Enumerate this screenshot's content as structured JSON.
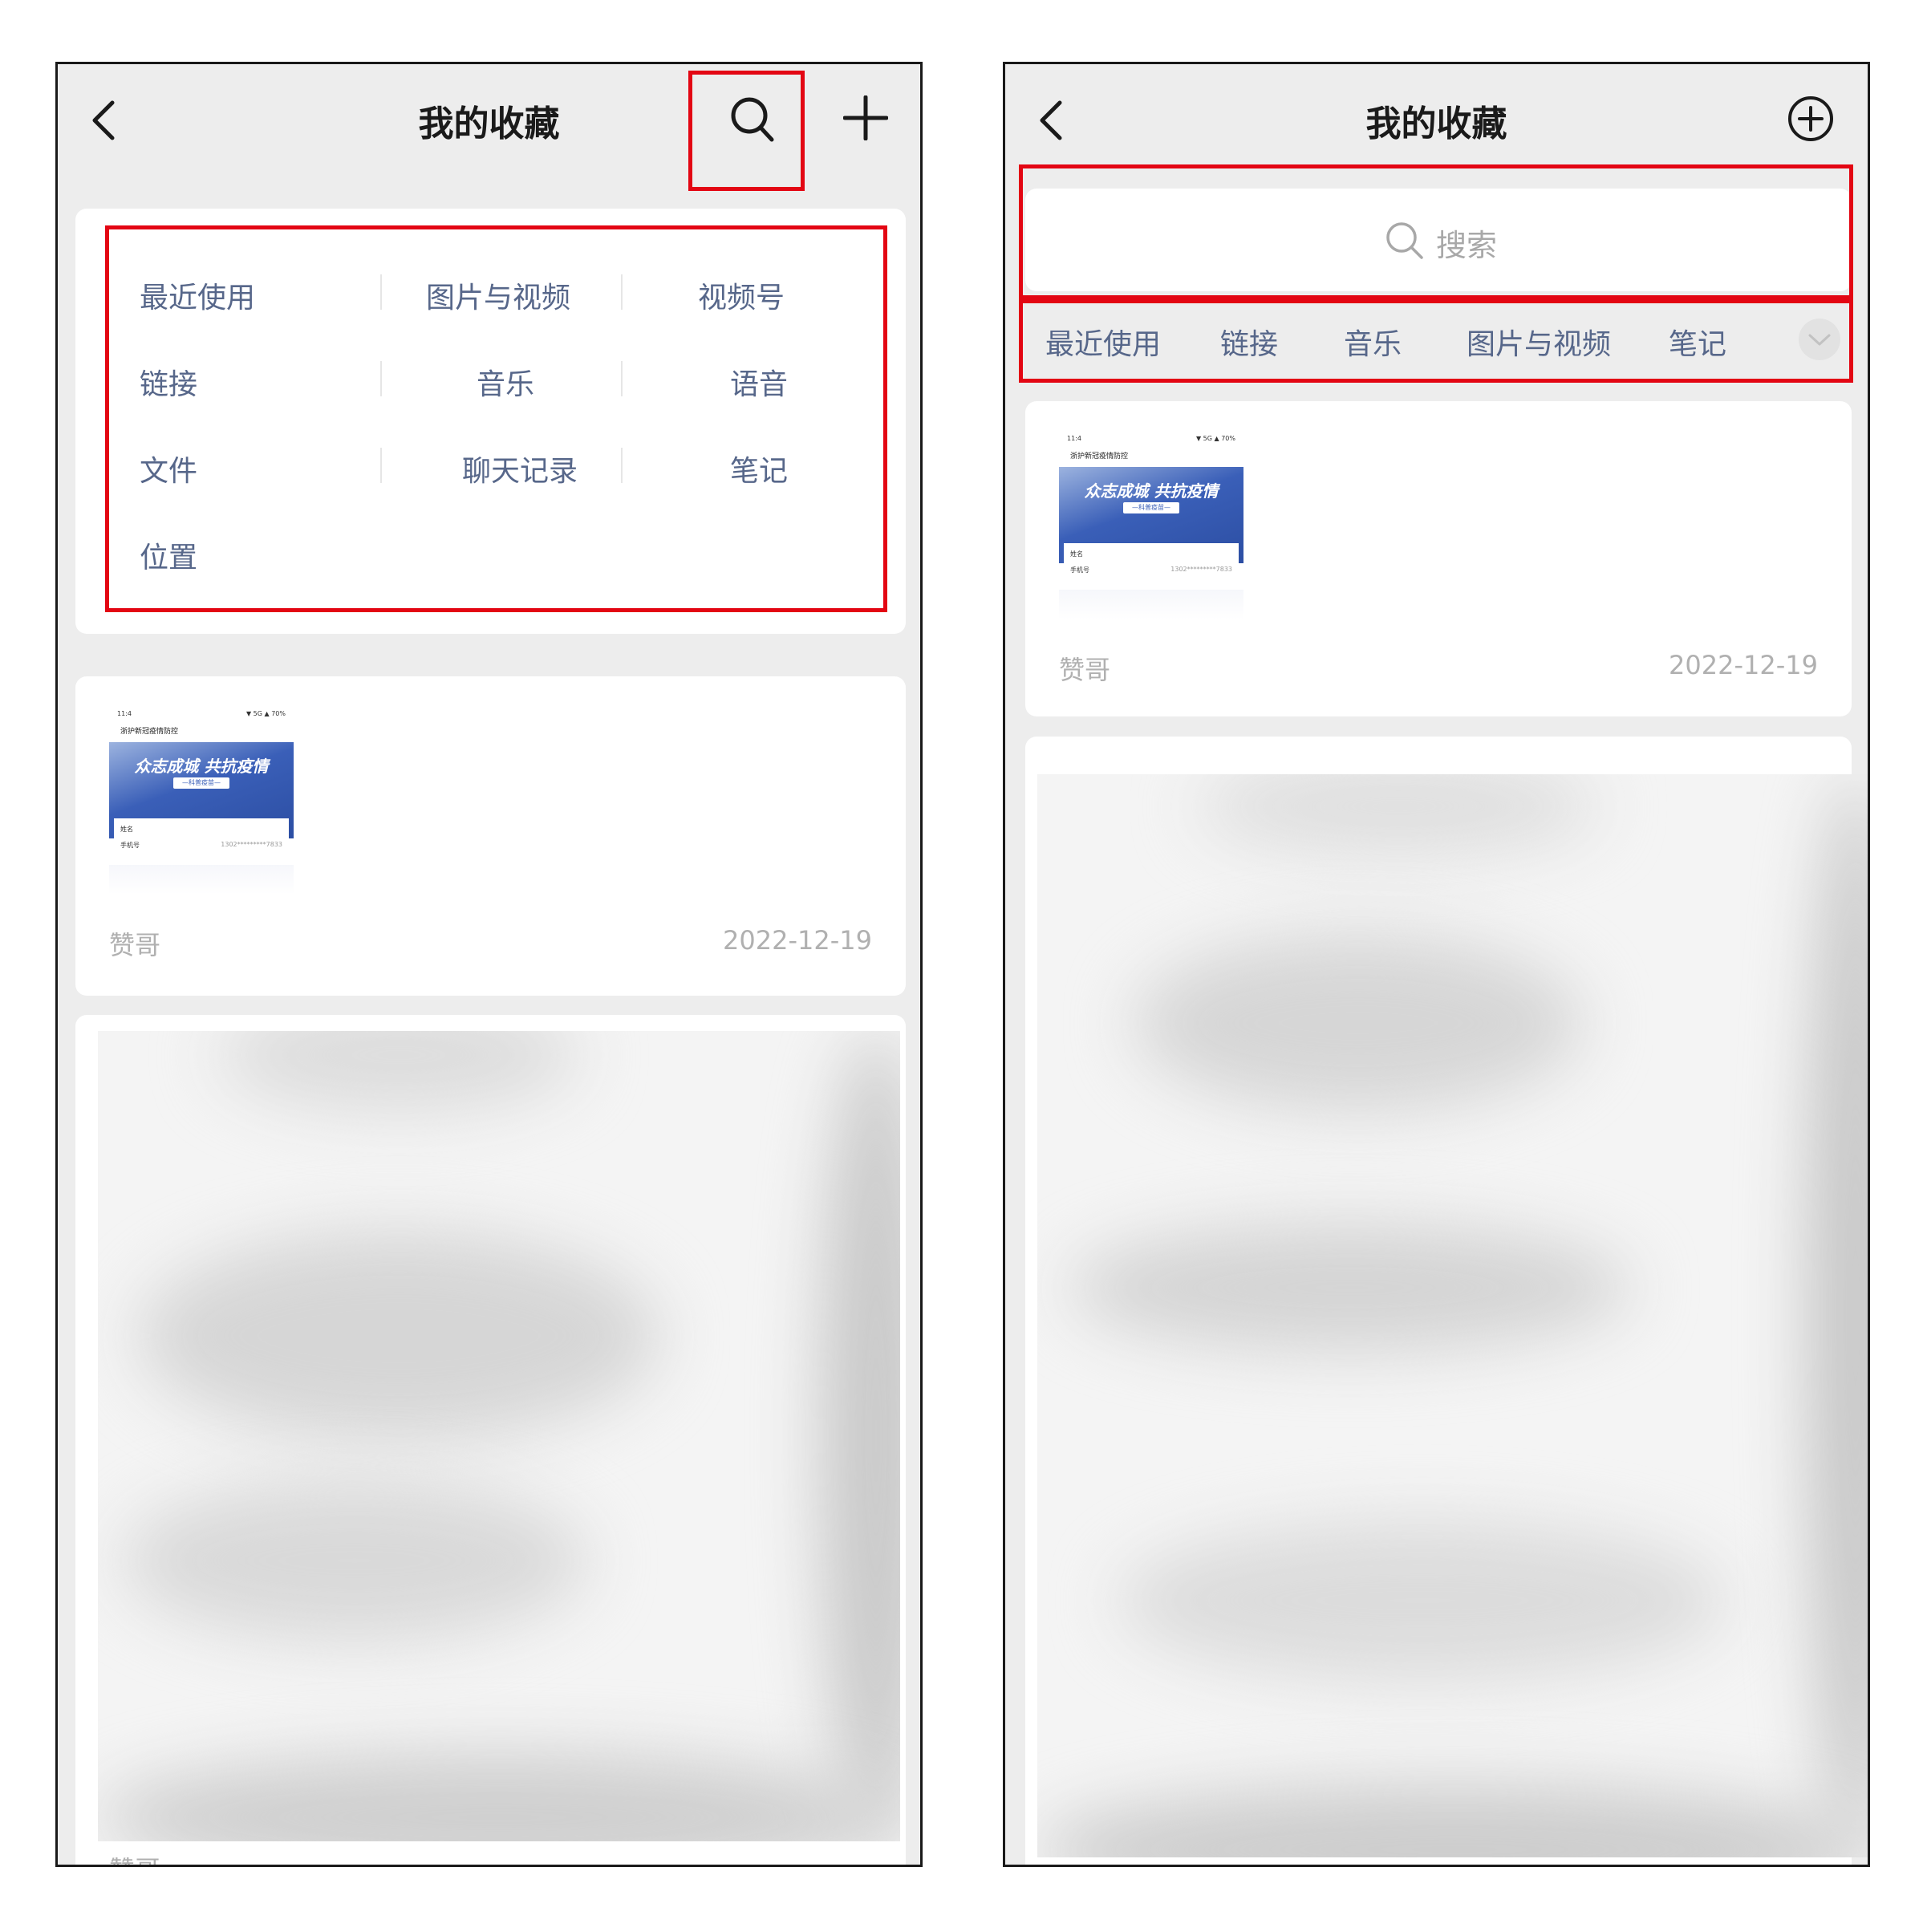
{
  "left_screen": {
    "title": "我的收藏",
    "categories": [
      [
        "最近使用",
        "图片与视频",
        "视频号"
      ],
      [
        "链接",
        "音乐",
        "语音"
      ],
      [
        "文件",
        "聊天记录",
        "笔记"
      ],
      [
        "位置"
      ]
    ],
    "item": {
      "thumb": {
        "status_left": "11:4",
        "status_right": "▼ 5G ▲ 70%",
        "nav_title": "浙护新冠疫情防控",
        "banner_title": "众志成城 共抗疫情",
        "banner_sub": "—科普疫苗—",
        "field_name": "姓名",
        "field_phone": "手机号",
        "field_phone_value": "1302*********7833"
      },
      "author": "赞哥",
      "date": "2022-12-19"
    },
    "bottom_author": "赞哥"
  },
  "right_screen": {
    "title": "我的收藏",
    "search": {
      "placeholder": "搜索"
    },
    "tabs": [
      "最近使用",
      "链接",
      "音乐",
      "图片与视频",
      "笔记"
    ],
    "item": {
      "author": "赞哥",
      "date": "2022-12-19"
    }
  },
  "colors": {
    "highlight": "#e30613",
    "category_text": "#57678a",
    "background": "#ededed"
  }
}
